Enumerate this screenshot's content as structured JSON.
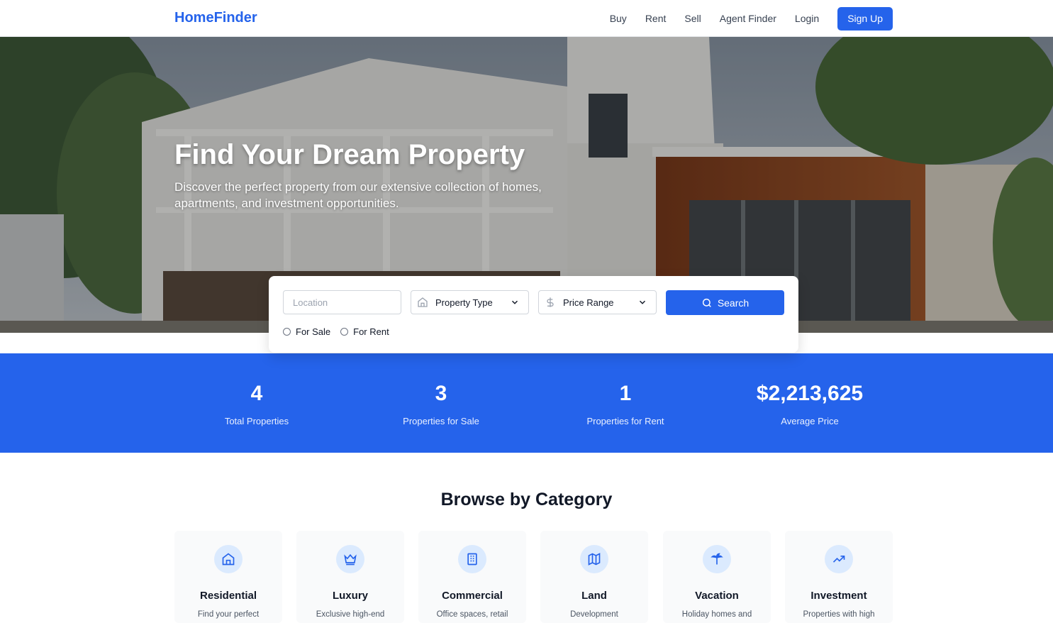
{
  "brand": "HomeFinder",
  "nav": {
    "links": [
      "Buy",
      "Rent",
      "Sell",
      "Agent Finder",
      "Login"
    ],
    "cta": "Sign Up"
  },
  "hero": {
    "title": "Find Your Dream Property",
    "subtitle": "Discover the perfect property from our extensive collection of homes, apartments, and investment opportunities."
  },
  "search": {
    "location_placeholder": "Location",
    "property_type": "Property Type",
    "price_range": "Price Range",
    "button": "Search",
    "options": [
      "For Sale",
      "For Rent"
    ]
  },
  "stats": [
    {
      "value": "4",
      "label": "Total Properties"
    },
    {
      "value": "3",
      "label": "Properties for Sale"
    },
    {
      "value": "1",
      "label": "Properties for Rent"
    },
    {
      "value": "$2,213,625",
      "label": "Average Price"
    }
  ],
  "categories": {
    "title": "Browse by Category",
    "items": [
      {
        "name": "Residential",
        "desc": "Find your perfect",
        "icon": "home-icon"
      },
      {
        "name": "Luxury",
        "desc": "Exclusive high-end",
        "icon": "crown-icon"
      },
      {
        "name": "Commercial",
        "desc": "Office spaces, retail",
        "icon": "building-icon"
      },
      {
        "name": "Land",
        "desc": "Development",
        "icon": "map-icon"
      },
      {
        "name": "Vacation",
        "desc": "Holiday homes and",
        "icon": "palm-tree-icon"
      },
      {
        "name": "Investment",
        "desc": "Properties with high",
        "icon": "trending-up-icon"
      }
    ]
  },
  "colors": {
    "accent": "#2563eb",
    "accent_light": "#dbeafe"
  }
}
